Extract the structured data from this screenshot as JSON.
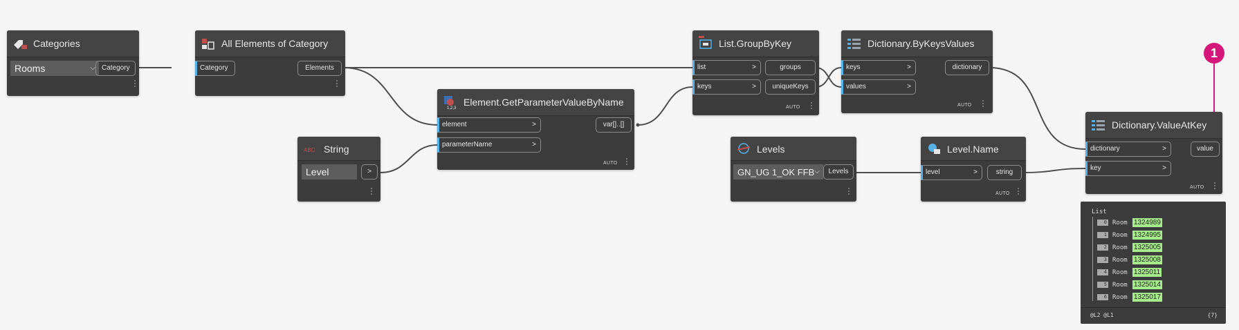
{
  "nodes": {
    "categories": {
      "title": "Categories",
      "dropdown": "Rooms",
      "out": "Category"
    },
    "all_elements": {
      "title": "All Elements of Category",
      "in": "Category",
      "out": "Elements"
    },
    "string": {
      "title": "String",
      "value": "Level",
      "out": ">"
    },
    "get_param": {
      "title": "Element.GetParameterValueByName",
      "in": [
        "element",
        "parameterName"
      ],
      "out": "var[]..[]",
      "lacing": "AUTO"
    },
    "group_by_key": {
      "title": "List.GroupByKey",
      "in": [
        "list",
        "keys"
      ],
      "out": [
        "groups",
        "uniqueKeys"
      ],
      "lacing": "AUTO"
    },
    "by_keys_values": {
      "title": "Dictionary.ByKeysValues",
      "in": [
        "keys",
        "values"
      ],
      "out": "dictionary",
      "lacing": "AUTO"
    },
    "levels": {
      "title": "Levels",
      "dropdown": "GN_UG 1_OK FFB",
      "out": "Levels"
    },
    "level_name": {
      "title": "Level.Name",
      "in": "level",
      "out": "string",
      "lacing": "AUTO"
    },
    "value_at_key": {
      "title": "Dictionary.ValueAtKey",
      "in": [
        "dictionary",
        "key"
      ],
      "out": "value",
      "lacing": "AUTO"
    }
  },
  "port_arrow": ">",
  "preview": {
    "header": "List",
    "items": [
      {
        "index": "0",
        "label": "Room",
        "value": "1324989"
      },
      {
        "index": "1",
        "label": "Room",
        "value": "1324995"
      },
      {
        "index": "2",
        "label": "Room",
        "value": "1325005"
      },
      {
        "index": "3",
        "label": "Room",
        "value": "1325008"
      },
      {
        "index": "4",
        "label": "Room",
        "value": "1325011"
      },
      {
        "index": "5",
        "label": "Room",
        "value": "1325014"
      },
      {
        "index": "6",
        "label": "Room",
        "value": "1325017"
      }
    ],
    "footer_levels": "@L2 @L1",
    "footer_count": "{7}"
  },
  "callout": "1",
  "colors": {
    "canvas": "#f5f5f5",
    "node": "#3c3c3c",
    "wire": "#4d4d4d",
    "port_accent": "#56b2e6",
    "value_highlight": "#a6ec8a",
    "callout": "#d6177a"
  }
}
